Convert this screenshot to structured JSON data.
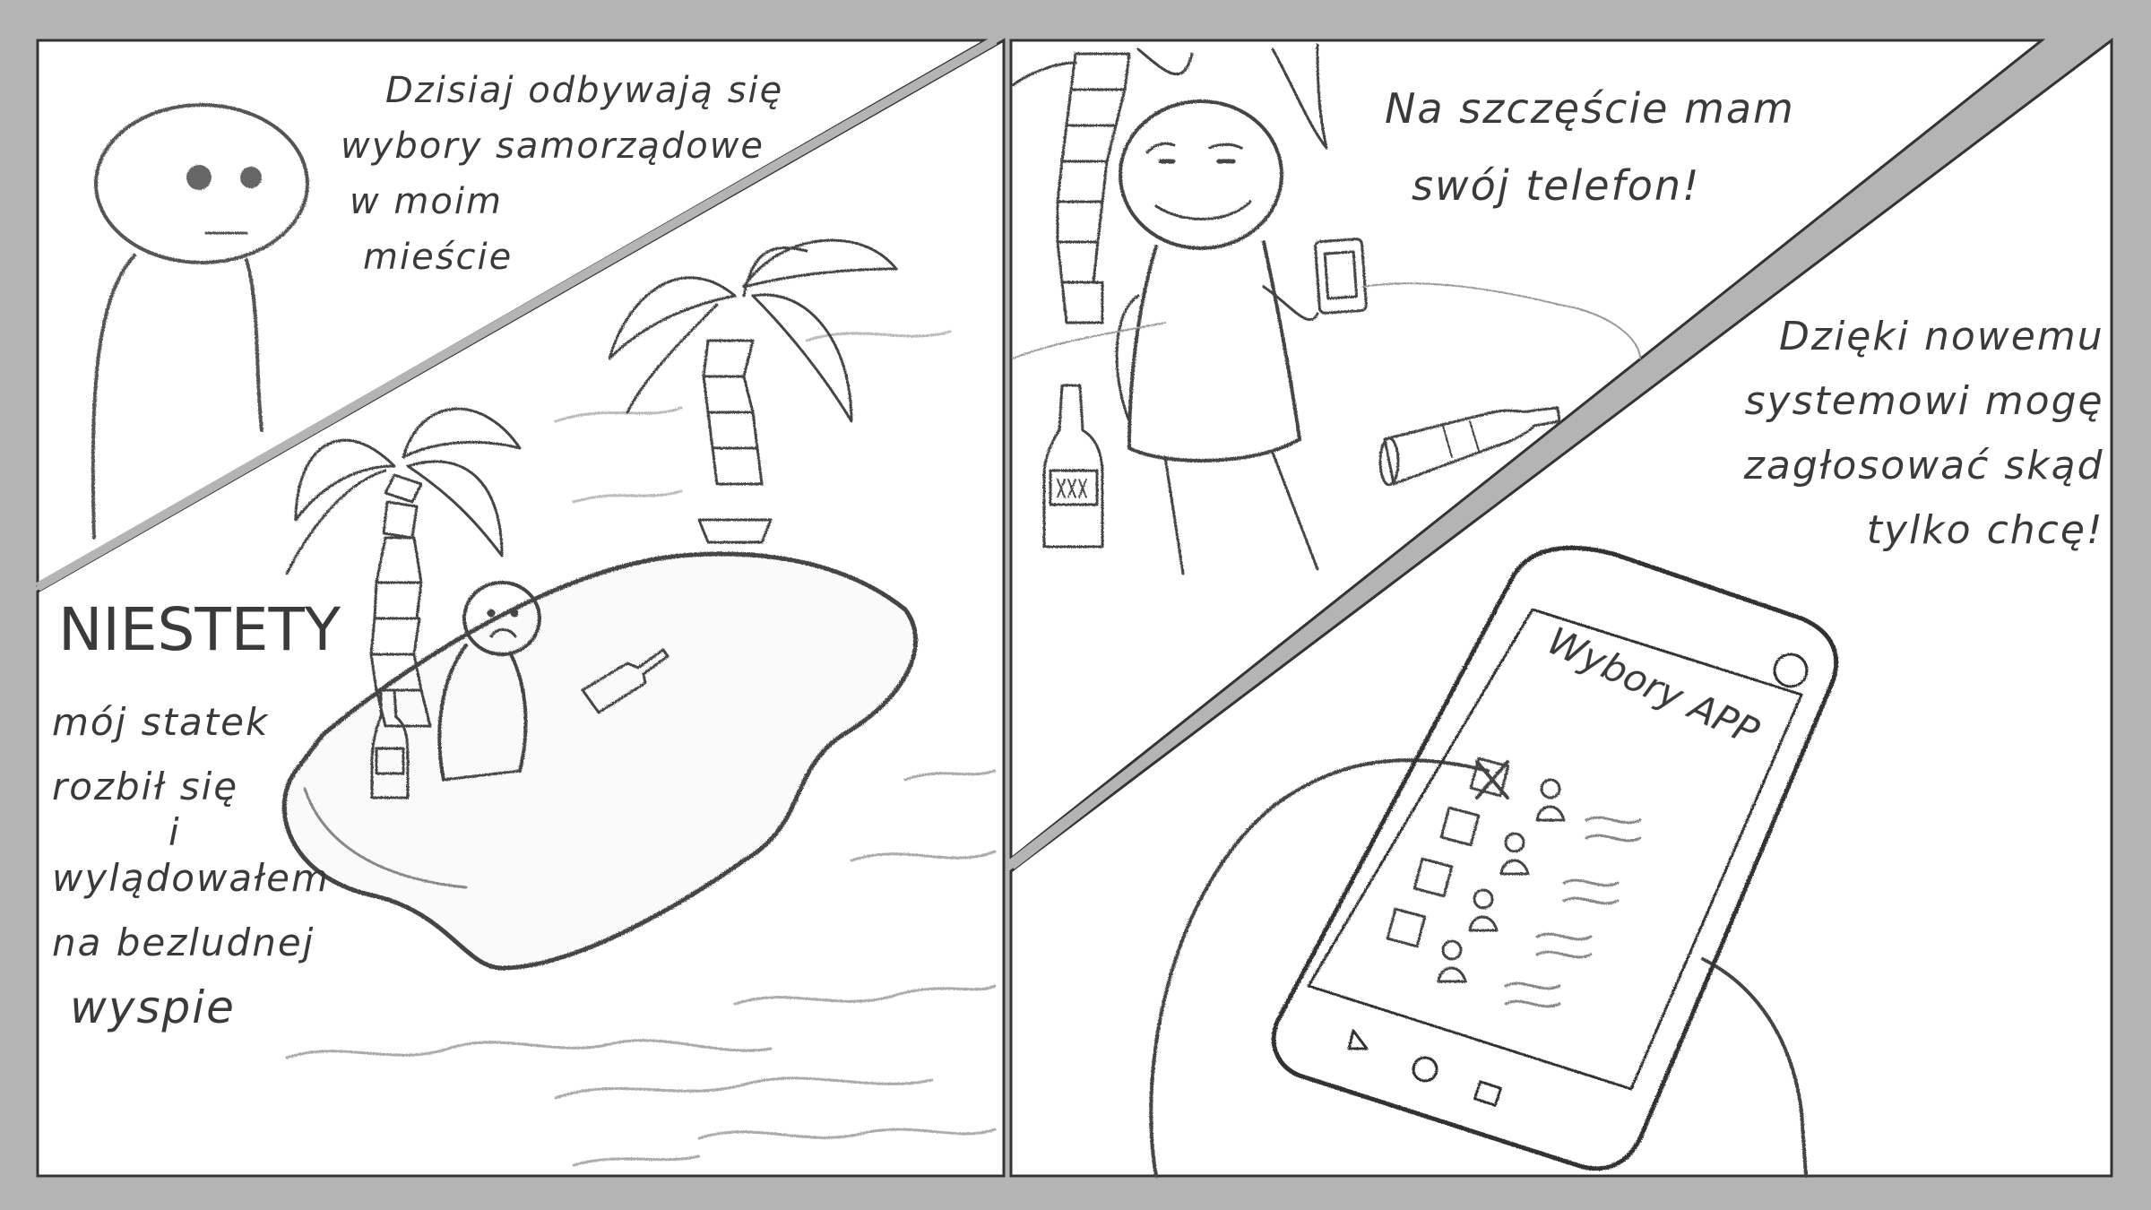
{
  "panel1": {
    "caption_lines": [
      "Dzisiaj odbywają się",
      "wybory samorządowe",
      "w moim",
      "mieście"
    ]
  },
  "panel2": {
    "headline": "NIESTETY",
    "caption_lines": [
      "mój statek",
      "rozbił się",
      "i",
      "wylądowałem",
      "na bezludnej",
      "wyspie"
    ]
  },
  "panel3": {
    "caption_lines": [
      "Na szczęście mam",
      "swój telefon!"
    ]
  },
  "panel4": {
    "caption_lines": [
      "Dzięki nowemu",
      "systemowi mogę",
      "zagłosować skąd",
      "tylko chcę!"
    ],
    "app_title": "Wybory APP"
  },
  "colors": {
    "background": "#b4b4b4",
    "panel": "#ffffff",
    "ink": "#3a3a3a",
    "pencil": "#8a8a8a"
  }
}
